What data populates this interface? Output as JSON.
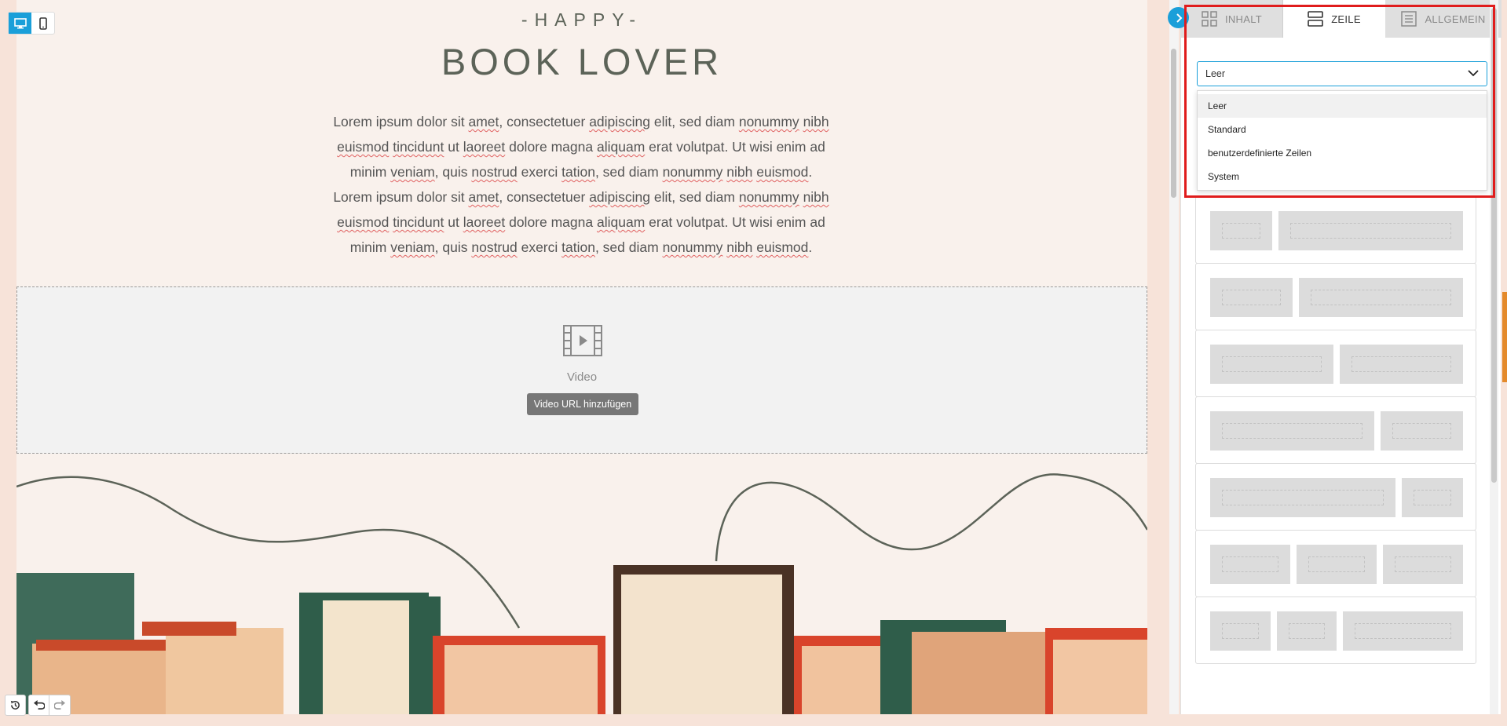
{
  "canvas": {
    "pre_title": "-HAPPY-",
    "title": "BOOK LOVER",
    "paragraph_lines": [
      [
        {
          "t": "Lorem ipsum dolor sit "
        },
        {
          "t": "amet",
          "s": true
        },
        {
          "t": ", consectetuer "
        },
        {
          "t": "adipiscing",
          "s": true
        },
        {
          "t": " elit, sed diam "
        },
        {
          "t": "nonummy",
          "s": true
        },
        {
          "t": " "
        },
        {
          "t": "nibh",
          "s": true
        }
      ],
      [
        {
          "t": "euismod",
          "s": true
        },
        {
          "t": " "
        },
        {
          "t": "tincidunt",
          "s": true
        },
        {
          "t": " ut "
        },
        {
          "t": "laoreet",
          "s": true
        },
        {
          "t": " dolore magna "
        },
        {
          "t": "aliquam",
          "s": true
        },
        {
          "t": " erat volutpat. Ut wisi enim ad"
        }
      ],
      [
        {
          "t": "minim "
        },
        {
          "t": "veniam",
          "s": true
        },
        {
          "t": ", quis "
        },
        {
          "t": "nostrud",
          "s": true
        },
        {
          "t": " exerci "
        },
        {
          "t": "tation",
          "s": true
        },
        {
          "t": ", sed diam "
        },
        {
          "t": "nonummy",
          "s": true
        },
        {
          "t": " "
        },
        {
          "t": "nibh",
          "s": true
        },
        {
          "t": " "
        },
        {
          "t": "euismod",
          "s": true
        },
        {
          "t": "."
        }
      ],
      [
        {
          "t": "Lorem ipsum dolor sit "
        },
        {
          "t": "amet",
          "s": true
        },
        {
          "t": ", consectetuer "
        },
        {
          "t": "adipiscing",
          "s": true
        },
        {
          "t": " elit, sed diam "
        },
        {
          "t": "nonummy",
          "s": true
        },
        {
          "t": " "
        },
        {
          "t": "nibh",
          "s": true
        }
      ],
      [
        {
          "t": "euismod",
          "s": true
        },
        {
          "t": " "
        },
        {
          "t": "tincidunt",
          "s": true
        },
        {
          "t": " ut "
        },
        {
          "t": "laoreet",
          "s": true
        },
        {
          "t": " dolore magna "
        },
        {
          "t": "aliquam",
          "s": true
        },
        {
          "t": " erat volutpat. Ut wisi enim ad"
        }
      ],
      [
        {
          "t": "minim "
        },
        {
          "t": "veniam",
          "s": true
        },
        {
          "t": ", quis "
        },
        {
          "t": "nostrud",
          "s": true
        },
        {
          "t": " exerci "
        },
        {
          "t": "tation",
          "s": true
        },
        {
          "t": ", sed diam "
        },
        {
          "t": "nonummy",
          "s": true
        },
        {
          "t": " "
        },
        {
          "t": "nibh",
          "s": true
        },
        {
          "t": " "
        },
        {
          "t": "euismod",
          "s": true
        },
        {
          "t": "."
        }
      ]
    ],
    "video": {
      "label": "Video",
      "button_label": "Video URL hinzufügen",
      "icon": "video-film-icon"
    }
  },
  "toolbar": {
    "device_icons": [
      "desktop-icon",
      "mobile-icon"
    ],
    "active_device": "desktop",
    "history_icons": [
      "history-icon",
      "undo-icon",
      "redo-icon"
    ]
  },
  "panel": {
    "tabs": [
      {
        "label": "INHALT",
        "icon": "grid-icon",
        "active": false
      },
      {
        "label": "ZEILE",
        "icon": "rows-icon",
        "active": true
      },
      {
        "label": "ALLGEMEIN",
        "icon": "document-icon",
        "active": false
      }
    ],
    "select": {
      "value": "Leer",
      "options": [
        "Leer",
        "Standard",
        "benutzerdefinierte Zeilen",
        "System"
      ]
    },
    "row_layouts": [
      {
        "columns": [
          1,
          3
        ]
      },
      {
        "columns": [
          1,
          2
        ]
      },
      {
        "columns": [
          1,
          1
        ]
      },
      {
        "columns": [
          2,
          1
        ]
      },
      {
        "columns": [
          3,
          1
        ]
      },
      {
        "columns": [
          1,
          1,
          1
        ]
      },
      {
        "columns": [
          1,
          1,
          2
        ]
      }
    ]
  },
  "colors": {
    "accent": "#1a9fd9",
    "highlight": "#e01c1c",
    "title_text": "#5c6358",
    "canvas_bg": "#f9f1ec",
    "spell_underline": "#e06060"
  }
}
